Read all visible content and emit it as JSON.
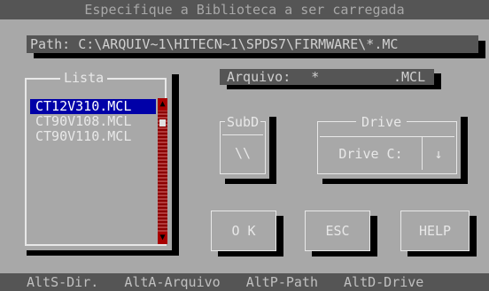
{
  "title": "Especifique a Biblioteca a ser carregada",
  "path": {
    "label": "Path:",
    "value": "C:\\ARQUIV~1\\HITECN~1\\SPDS7\\FIRMWARE\\*.MC"
  },
  "list": {
    "title": "Lista",
    "items": [
      "CT12V310.MCL",
      "CT90V108.MCL",
      "CT90V110.MCL"
    ],
    "selected_index": 0,
    "scroll_up_glyph": "▲",
    "scroll_down_glyph": "▼"
  },
  "arquivo": {
    "label": "Arquivo:",
    "value": "*",
    "ext": ".MCL"
  },
  "subdir": {
    "title": "SubD",
    "button": "\\\\"
  },
  "drive": {
    "title": "Drive",
    "value": "Drive C:",
    "arrow": "↓"
  },
  "buttons": {
    "ok": "O K",
    "esc": "ESC",
    "help": "HELP"
  },
  "status": {
    "items": [
      "AltS-Dir.",
      "AltA-Arquivo",
      "AltP-Path",
      "AltD-Drive"
    ]
  },
  "colors": {
    "background": "#a8a8a8",
    "dark_bar": "#555555",
    "selection": "#0000a8",
    "scrollbar": "#a80000"
  }
}
